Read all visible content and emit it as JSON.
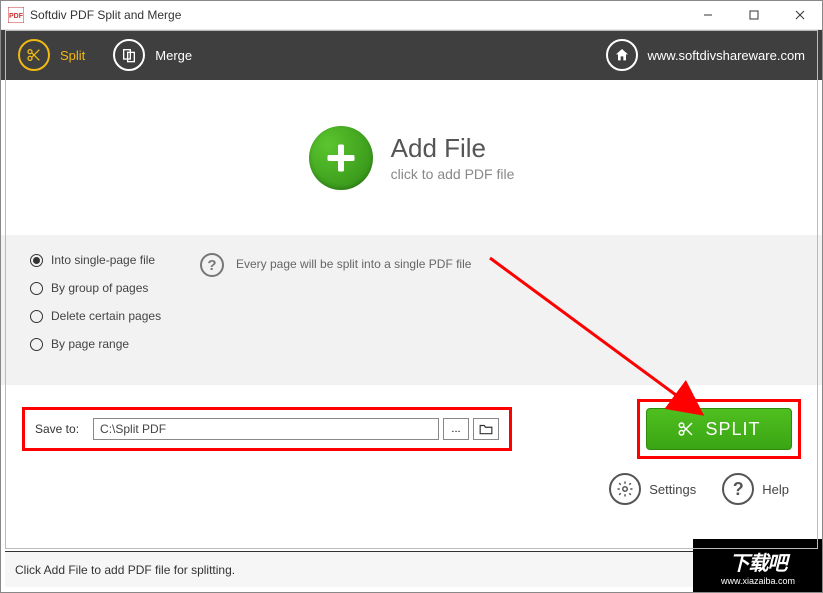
{
  "window": {
    "title": "Softdiv PDF Split and Merge"
  },
  "toolbar": {
    "split": "Split",
    "merge": "Merge",
    "website": "www.softdivshareware.com"
  },
  "addfile": {
    "heading": "Add File",
    "sub": "click to add PDF file"
  },
  "options": {
    "r1": "Into single-page file",
    "r2": "By group of pages",
    "r3": "Delete certain pages",
    "r4": "By page range",
    "desc": "Every page will be split into a single PDF file"
  },
  "save": {
    "label": "Save to:",
    "path": "C:\\Split PDF",
    "ellipsis": "...",
    "split_btn": "SPLIT"
  },
  "bottom": {
    "settings": "Settings",
    "help": "Help"
  },
  "status": {
    "text": "Click Add File to add PDF file for splitting."
  },
  "watermark": {
    "big": "下载吧",
    "url": "www.xiazaiba.com"
  }
}
